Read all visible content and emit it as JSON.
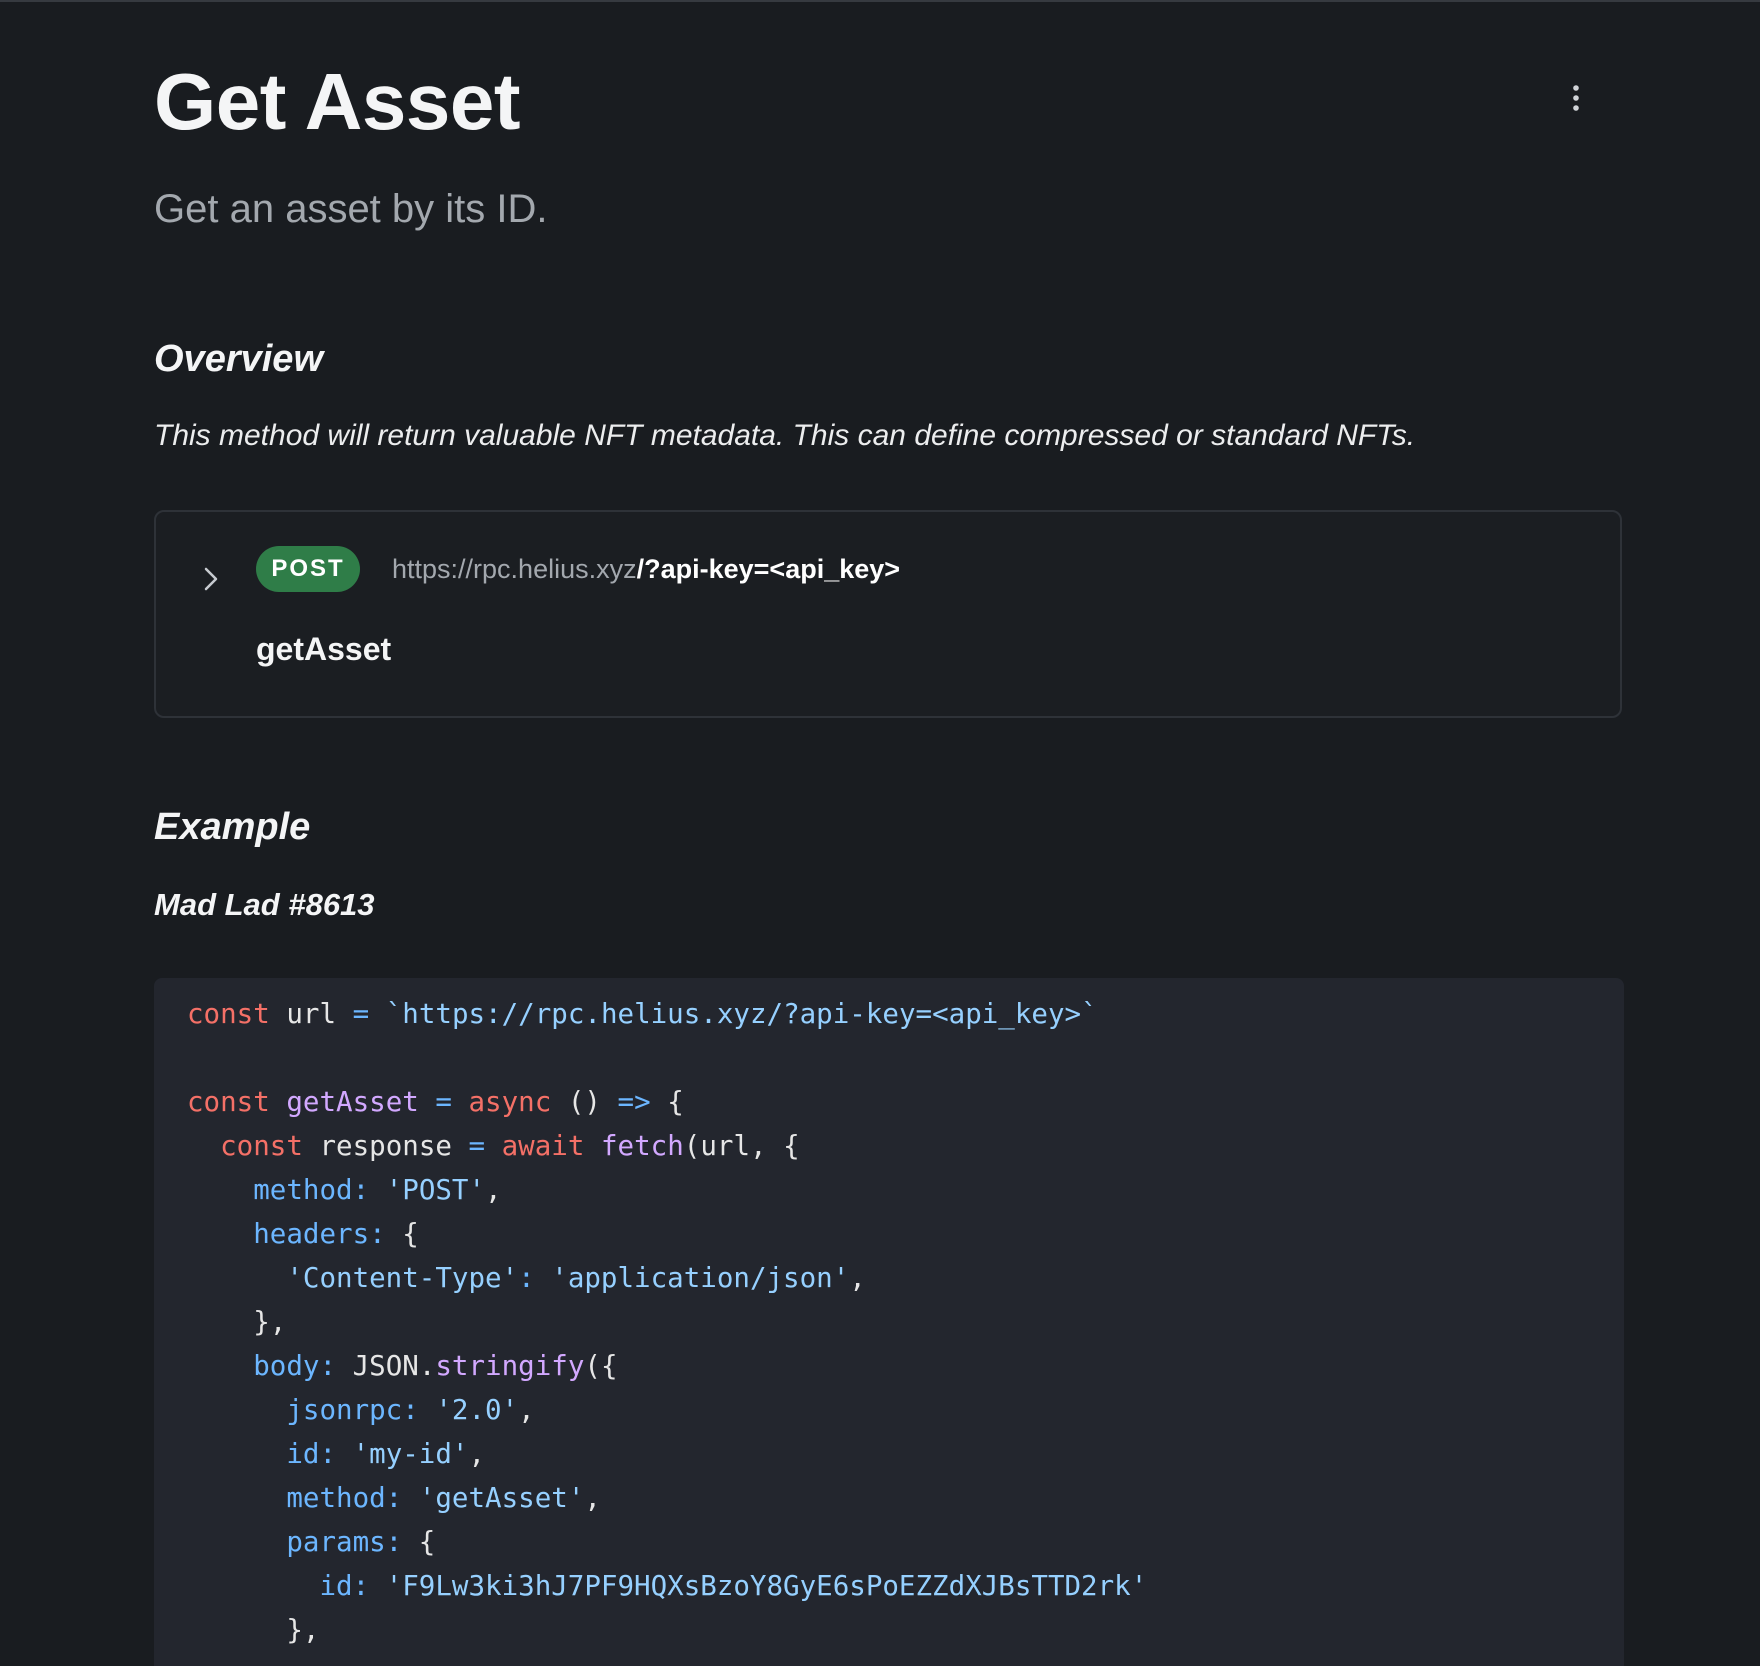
{
  "page": {
    "title": "Get Asset",
    "subtitle": "Get an asset by its ID."
  },
  "overview": {
    "heading": "Overview",
    "text": "This method will return valuable NFT metadata. This can define compressed or standard NFTs."
  },
  "endpoint": {
    "method": "POST",
    "url_base": "https://rpc.helius.xyz",
    "url_path": "/?api-key=<api_key>",
    "name": "getAsset"
  },
  "example": {
    "heading": "Example",
    "subheading": "Mad Lad #8613"
  },
  "code": {
    "language": "javascript",
    "lines": [
      [
        {
          "t": "kw",
          "v": "const"
        },
        {
          "t": "plain",
          "v": " url "
        },
        {
          "t": "op",
          "v": "="
        },
        {
          "t": "plain",
          "v": " "
        },
        {
          "t": "str",
          "v": "`https://rpc.helius.xyz/?api-key=<api_key>`"
        }
      ],
      [],
      [
        {
          "t": "kw",
          "v": "const"
        },
        {
          "t": "plain",
          "v": " "
        },
        {
          "t": "fn",
          "v": "getAsset"
        },
        {
          "t": "plain",
          "v": " "
        },
        {
          "t": "op",
          "v": "="
        },
        {
          "t": "plain",
          "v": " "
        },
        {
          "t": "kw",
          "v": "async"
        },
        {
          "t": "plain",
          "v": " () "
        },
        {
          "t": "op",
          "v": "=>"
        },
        {
          "t": "plain",
          "v": " {"
        }
      ],
      [
        {
          "t": "plain",
          "v": "  "
        },
        {
          "t": "kw",
          "v": "const"
        },
        {
          "t": "plain",
          "v": " response "
        },
        {
          "t": "op",
          "v": "="
        },
        {
          "t": "plain",
          "v": " "
        },
        {
          "t": "kw",
          "v": "await"
        },
        {
          "t": "plain",
          "v": " "
        },
        {
          "t": "fn",
          "v": "fetch"
        },
        {
          "t": "plain",
          "v": "(url, {"
        }
      ],
      [
        {
          "t": "plain",
          "v": "    "
        },
        {
          "t": "prop",
          "v": "method:"
        },
        {
          "t": "plain",
          "v": " "
        },
        {
          "t": "str",
          "v": "'POST'"
        },
        {
          "t": "plain",
          "v": ","
        }
      ],
      [
        {
          "t": "plain",
          "v": "    "
        },
        {
          "t": "prop",
          "v": "headers:"
        },
        {
          "t": "plain",
          "v": " {"
        }
      ],
      [
        {
          "t": "plain",
          "v": "      "
        },
        {
          "t": "str",
          "v": "'Content-Type'"
        },
        {
          "t": "prop",
          "v": ":"
        },
        {
          "t": "plain",
          "v": " "
        },
        {
          "t": "str",
          "v": "'application/json'"
        },
        {
          "t": "plain",
          "v": ","
        }
      ],
      [
        {
          "t": "plain",
          "v": "    },"
        }
      ],
      [
        {
          "t": "plain",
          "v": "    "
        },
        {
          "t": "prop",
          "v": "body:"
        },
        {
          "t": "plain",
          "v": " JSON."
        },
        {
          "t": "fn",
          "v": "stringify"
        },
        {
          "t": "plain",
          "v": "({"
        }
      ],
      [
        {
          "t": "plain",
          "v": "      "
        },
        {
          "t": "prop",
          "v": "jsonrpc:"
        },
        {
          "t": "plain",
          "v": " "
        },
        {
          "t": "str",
          "v": "'2.0'"
        },
        {
          "t": "plain",
          "v": ","
        }
      ],
      [
        {
          "t": "plain",
          "v": "      "
        },
        {
          "t": "prop",
          "v": "id:"
        },
        {
          "t": "plain",
          "v": " "
        },
        {
          "t": "str",
          "v": "'my-id'"
        },
        {
          "t": "plain",
          "v": ","
        }
      ],
      [
        {
          "t": "plain",
          "v": "      "
        },
        {
          "t": "prop",
          "v": "method:"
        },
        {
          "t": "plain",
          "v": " "
        },
        {
          "t": "str",
          "v": "'getAsset'"
        },
        {
          "t": "plain",
          "v": ","
        }
      ],
      [
        {
          "t": "plain",
          "v": "      "
        },
        {
          "t": "prop",
          "v": "params:"
        },
        {
          "t": "plain",
          "v": " {"
        }
      ],
      [
        {
          "t": "plain",
          "v": "        "
        },
        {
          "t": "prop",
          "v": "id:"
        },
        {
          "t": "plain",
          "v": " "
        },
        {
          "t": "str",
          "v": "'F9Lw3ki3hJ7PF9HQXsBzoY8GyE6sPoEZZdXJBsTTD2rk'"
        }
      ],
      [
        {
          "t": "plain",
          "v": "      },"
        }
      ]
    ]
  },
  "icons": {
    "more": "more-vertical-icon",
    "expand": "chevron-right-icon"
  },
  "colors": {
    "background": "#191c20",
    "code_background": "#23262e",
    "post_badge": "#2f7d48",
    "keyword": "#f47067",
    "function": "#d2a8ff",
    "string": "#96d0ff",
    "property": "#6cb6ff"
  }
}
